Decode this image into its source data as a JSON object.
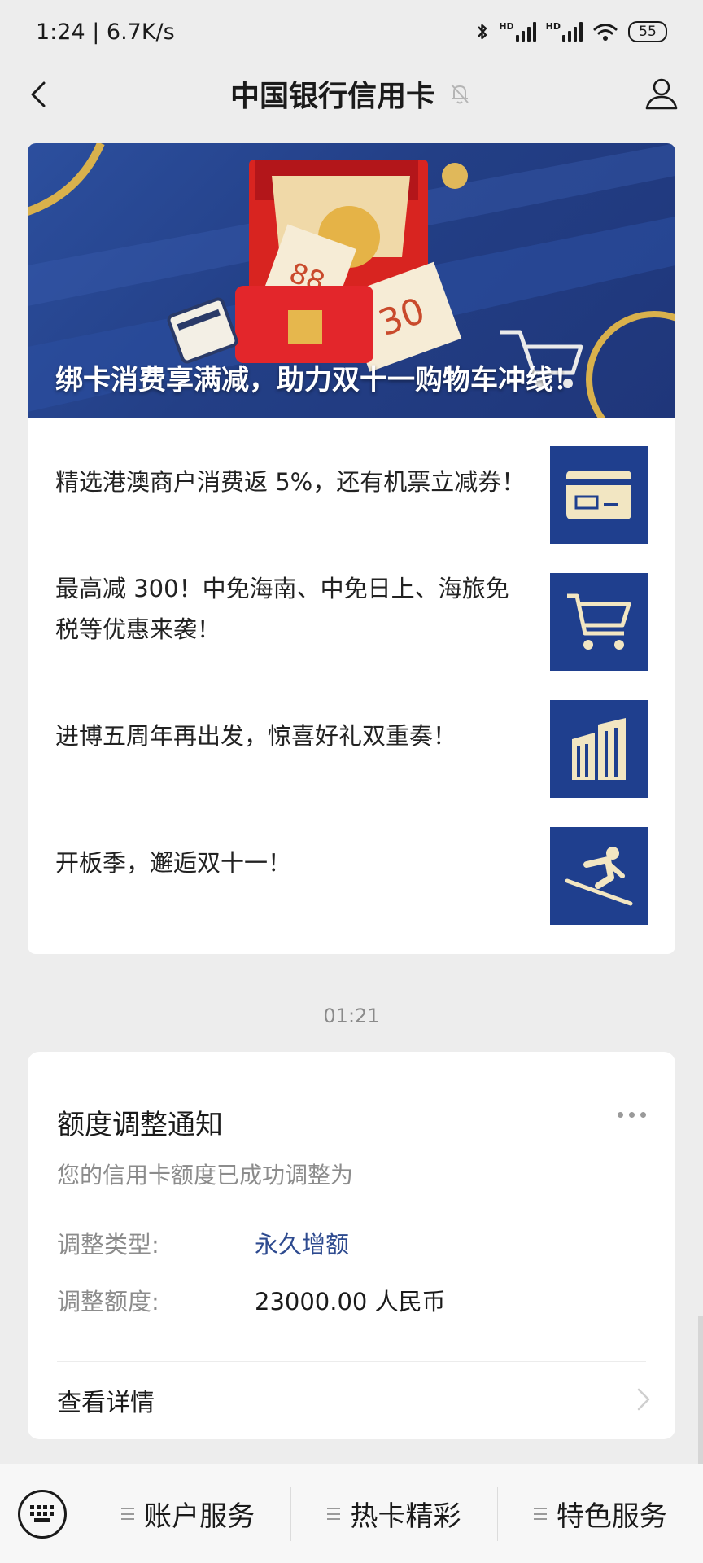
{
  "status_bar": {
    "time_speed": "1:24 | 6.7K/s",
    "battery": "55"
  },
  "nav": {
    "title": "中国银行信用卡"
  },
  "article": {
    "cover_title": "绑卡消费享满减，助力双十一购物车冲线！",
    "items": [
      {
        "text": "精选港澳商户消费返 5%，还有机票立减券！",
        "icon": "credit-card-icon"
      },
      {
        "text": "最高减 300！中免海南、中免日上、海旅免税等优惠来袭！",
        "icon": "shopping-cart-icon"
      },
      {
        "text": "进博五周年再出发，惊喜好礼双重奏！",
        "icon": "building-icon"
      },
      {
        "text": "开板季，邂逅双十一！",
        "icon": "skier-icon"
      }
    ]
  },
  "timestamp": "01:21",
  "notice": {
    "title": "额度调整通知",
    "subtitle": "您的信用卡额度已成功调整为",
    "type_label": "调整类型:",
    "type_value": "永久增额",
    "amount_label": "调整额度:",
    "amount_value": "23000.00 人民币",
    "detail_link": "查看详情"
  },
  "bottom_menu": {
    "items": [
      "账户服务",
      "热卡精彩",
      "特色服务"
    ]
  },
  "colors": {
    "brand_blue": "#1f3f8e",
    "value_blue": "#2d4a8f",
    "cover_red": "#d82420",
    "gold": "#e0b85a"
  }
}
